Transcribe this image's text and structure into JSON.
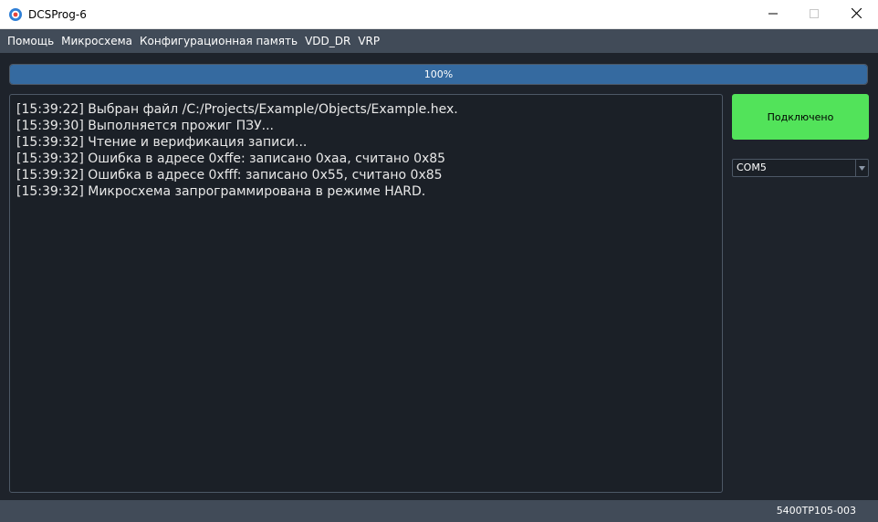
{
  "window": {
    "title": "DCSProg-6"
  },
  "menu": {
    "items": [
      {
        "label": "Помощь"
      },
      {
        "label": "Микросхема"
      },
      {
        "label": "Конфигурационная память"
      },
      {
        "label": "VDD_DR"
      },
      {
        "label": "VRP"
      }
    ]
  },
  "progress": {
    "value_percent": 100,
    "label": "100%"
  },
  "log": {
    "lines": [
      "[15:39:22] Выбран файл /C:/Projects/Example/Objects/Example.hex.",
      "[15:39:30] Выполняется прожиг ПЗУ...",
      "[15:39:32] Чтение и верификация записи...",
      "[15:39:32] Ошибка в адресе 0xffe: записано 0xaa, считано 0x85",
      "[15:39:32] Ошибка в адресе 0xfff: записано 0x55, считано 0x85",
      "[15:39:32] Микросхема запрограммирована в режиме HARD."
    ]
  },
  "connection": {
    "button_label": "Подключено",
    "status_color": "#52e35a"
  },
  "port": {
    "selected": "COM5"
  },
  "status": {
    "chip": "5400ТР105-003"
  },
  "icons": {
    "app": "app-logo-icon",
    "minimize": "minimize-icon",
    "maximize": "maximize-icon",
    "close": "close-icon",
    "dropdown": "chevron-down-icon"
  }
}
